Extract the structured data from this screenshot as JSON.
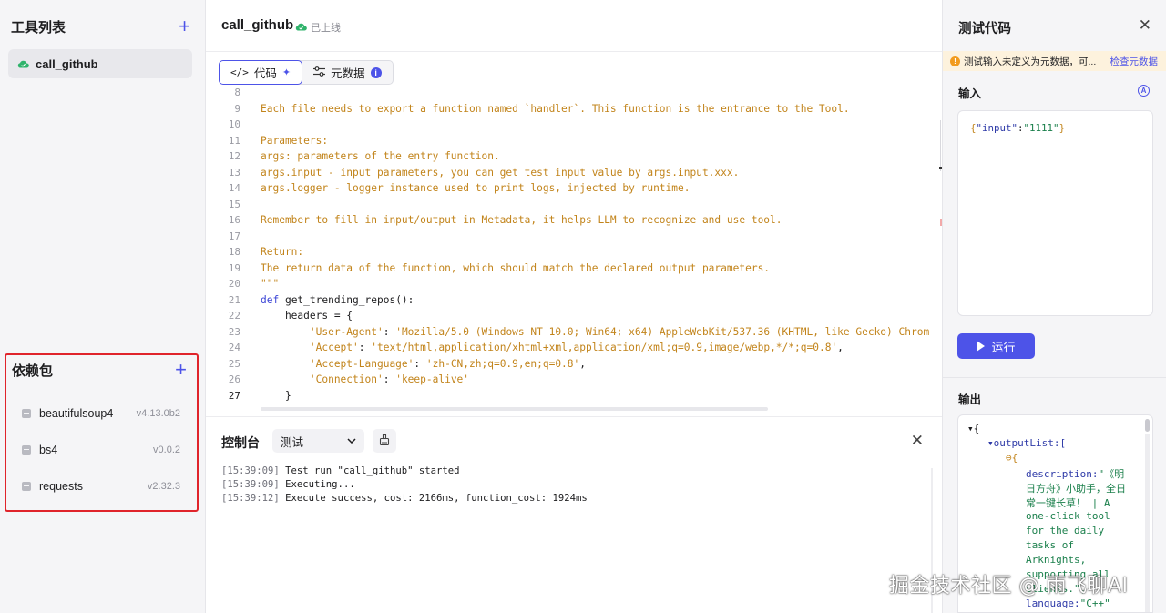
{
  "left": {
    "tools_title": "工具列表",
    "tools": [
      {
        "label": "call_github"
      }
    ],
    "deps_title": "依赖包",
    "deps": [
      {
        "name": "beautifulsoup4",
        "version": "v4.13.0b2"
      },
      {
        "name": "bs4",
        "version": "v0.0.2"
      },
      {
        "name": "requests",
        "version": "v2.32.3"
      }
    ]
  },
  "header": {
    "title": "call_github",
    "status": "已上线"
  },
  "tabs": [
    {
      "label": "代码",
      "icon": "code-icon"
    },
    {
      "label": "元数据",
      "icon": "sliders-icon"
    }
  ],
  "code_lines": [
    {
      "n": "8",
      "text": ""
    },
    {
      "n": "9",
      "text": "Each file needs to export a function named `handler`. This function is the entrance to the Tool."
    },
    {
      "n": "10",
      "text": ""
    },
    {
      "n": "11",
      "text": "Parameters:"
    },
    {
      "n": "12",
      "text": "args: parameters of the entry function."
    },
    {
      "n": "13",
      "text": "args.input - input parameters, you can get test input value by args.input.xxx."
    },
    {
      "n": "14",
      "text": "args.logger - logger instance used to print logs, injected by runtime."
    },
    {
      "n": "15",
      "text": ""
    },
    {
      "n": "16",
      "text": "Remember to fill in input/output in Metadata, it helps LLM to recognize and use tool."
    },
    {
      "n": "17",
      "text": ""
    },
    {
      "n": "18",
      "text": "Return:"
    },
    {
      "n": "19",
      "text": "The return data of the function, which should match the declared output parameters."
    },
    {
      "n": "20",
      "text": "\"\"\""
    },
    {
      "n": "21",
      "kw": "def",
      "text": " get_trending_repos():"
    },
    {
      "n": "22",
      "text": "    headers = {"
    },
    {
      "n": "23",
      "key": "        'User-Agent'",
      "text": ": ",
      "val": "'Mozilla/5.0 (Windows NT 10.0; Win64; x64) AppleWebKit/537.36 (KHTML, like Gecko) Chrom"
    },
    {
      "n": "24",
      "key": "        'Accept'",
      "text": ": ",
      "val": "'text/html,application/xhtml+xml,application/xml;q=0.9,image/webp,*/*;q=0.8'",
      "tail": ","
    },
    {
      "n": "25",
      "key": "        'Accept-Language'",
      "text": ": ",
      "val": "'zh-CN,zh;q=0.9,en;q=0.8'",
      "tail": ","
    },
    {
      "n": "26",
      "key": "        'Connection'",
      "text": ": ",
      "val": "'keep-alive'"
    },
    {
      "n": "27",
      "text": "    }"
    }
  ],
  "console": {
    "title": "控制台",
    "env": "测试",
    "logs": [
      {
        "ts": "[15:39:09]",
        "msg": " Test run \"call_github\" started"
      },
      {
        "ts": "[15:39:09]",
        "msg": " Executing..."
      },
      {
        "ts": "[15:39:12]",
        "msg": " Execute success, cost: 2166ms, function_cost: 1924ms"
      }
    ]
  },
  "right": {
    "title": "测试代码",
    "warning": "测试输入未定义为元数据，可...",
    "warning_link": "检查元数据",
    "input_label": "输入",
    "input_badge": "A",
    "input_json": {
      "open": "{",
      "key": "\"input\"",
      "colon": ":",
      "value": "\"1111\"",
      "close": "}"
    },
    "run_label": "运行",
    "output_label": "输出",
    "output_lines": [
      {
        "indent": 10,
        "text": "▾{",
        "type": "plain"
      },
      {
        "indent": 32,
        "text": "▾outputList:[",
        "type": "key"
      },
      {
        "indent": 52,
        "text": "⊖{",
        "type": "plain"
      },
      {
        "indent": 74,
        "text": "description:\"《明",
        "type": "mixed"
      },
      {
        "indent": 74,
        "text": "日方舟》小助手，全日",
        "type": "val"
      },
      {
        "indent": 74,
        "text": "常一键长草！ | A",
        "type": "val"
      },
      {
        "indent": 74,
        "text": "one-click tool",
        "type": "val"
      },
      {
        "indent": 74,
        "text": "for the daily",
        "type": "val"
      },
      {
        "indent": 74,
        "text": "tasks of",
        "type": "val"
      },
      {
        "indent": 74,
        "text": "Arknights,",
        "type": "val"
      },
      {
        "indent": 74,
        "text": "supporting all",
        "type": "val"
      },
      {
        "indent": 74,
        "text": "clients.\",",
        "type": "val"
      },
      {
        "indent": 74,
        "text": "language:\"C++\"",
        "type": "mixed"
      }
    ]
  },
  "watermark": "掘金技术社区 @ 雨飞聊AI",
  "colors": {
    "accent": "#4d53e8",
    "highlight": "#e0242b",
    "string": "#c2841b",
    "online": "#2fb36b"
  }
}
